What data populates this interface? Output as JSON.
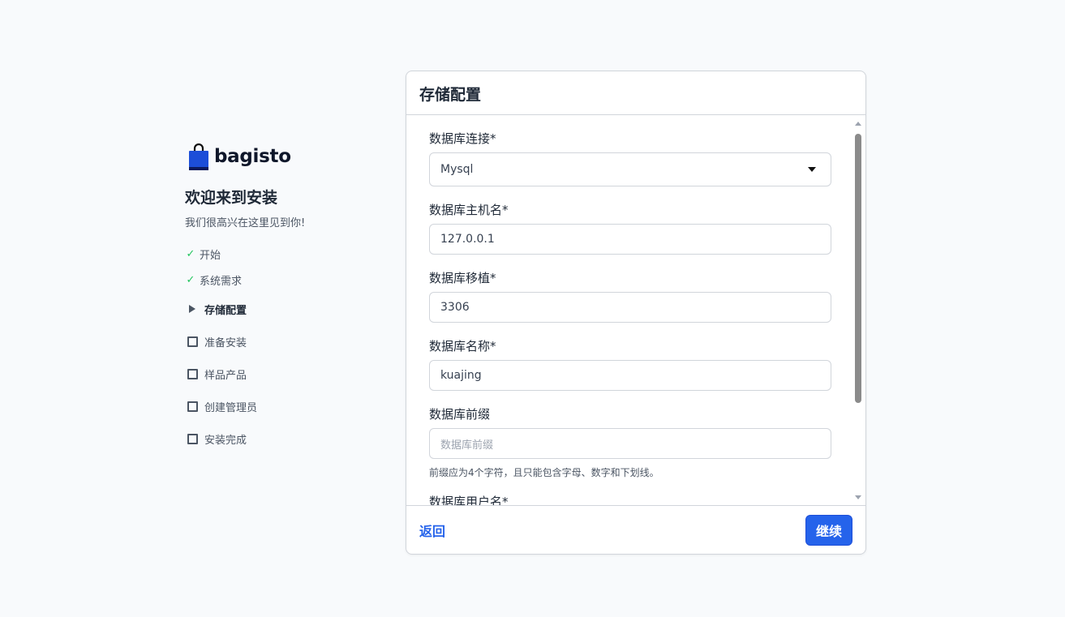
{
  "brand": {
    "name": "bagisto",
    "colors": {
      "bag": "#1d4ed8",
      "bag_base": "#0b1a5c"
    }
  },
  "welcome": {
    "title": "欢迎来到安装",
    "subtitle": "我们很高兴在这里见到你!"
  },
  "steps": [
    {
      "label": "开始",
      "status": "done",
      "icon": "check-icon"
    },
    {
      "label": "系统需求",
      "status": "done",
      "icon": "check-icon"
    },
    {
      "label": "存储配置",
      "status": "active",
      "icon": "triangle-right-icon"
    },
    {
      "label": "准备安装",
      "status": "todo",
      "icon": "checkbox-icon"
    },
    {
      "label": "样品产品",
      "status": "todo",
      "icon": "checkbox-icon"
    },
    {
      "label": "创建管理员",
      "status": "todo",
      "icon": "checkbox-icon"
    },
    {
      "label": "安装完成",
      "status": "todo",
      "icon": "checkbox-icon"
    }
  ],
  "card": {
    "title": "存储配置",
    "fields": {
      "connection": {
        "label": "数据库连接*",
        "value": "Mysql"
      },
      "host": {
        "label": "数据库主机名*",
        "value": "127.0.0.1"
      },
      "port": {
        "label": "数据库移植*",
        "value": "3306"
      },
      "name": {
        "label": "数据库名称*",
        "value": "kuajing"
      },
      "prefix": {
        "label": "数据库前缀",
        "placeholder": "数据库前缀",
        "hint": "前缀应为4个字符，且只能包含字母、数字和下划线。"
      },
      "username": {
        "label": "数据库用户名*"
      }
    },
    "footer": {
      "back_label": "返回",
      "continue_label": "继续"
    }
  },
  "colors": {
    "accent": "#2563eb",
    "check": "#22c55e",
    "background": "#f8fafc"
  }
}
